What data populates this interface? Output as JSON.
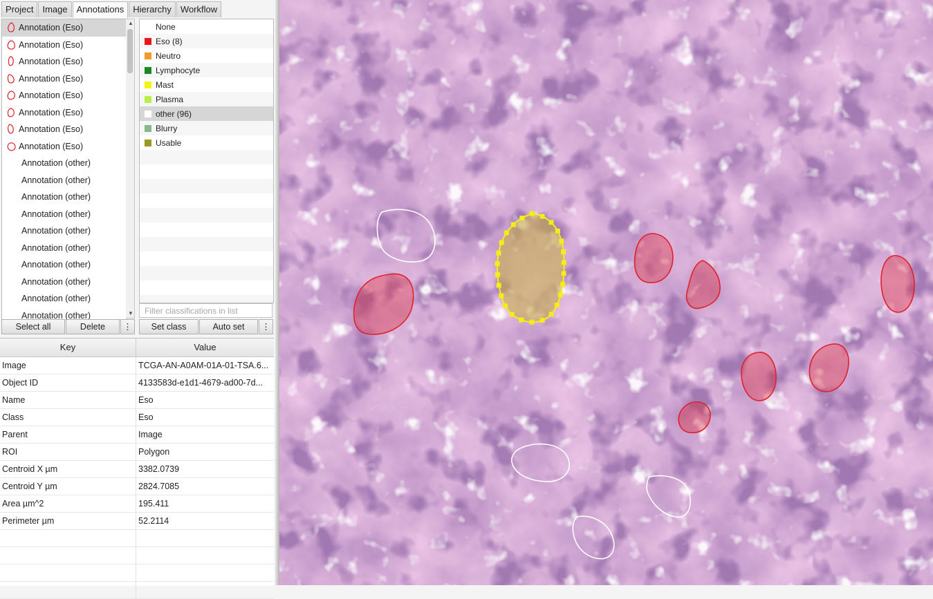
{
  "tabs": [
    "Project",
    "Image",
    "Annotations",
    "Hierarchy",
    "Workflow"
  ],
  "active_tab": "Annotations",
  "annotations": [
    {
      "label": "Annotation (Eso)",
      "color": "#e0202a",
      "selected": true
    },
    {
      "label": "Annotation (Eso)",
      "color": "#e0202a"
    },
    {
      "label": "Annotation (Eso)",
      "color": "#e0202a"
    },
    {
      "label": "Annotation (Eso)",
      "color": "#e0202a"
    },
    {
      "label": "Annotation (Eso)",
      "color": "#e0202a"
    },
    {
      "label": "Annotation (Eso)",
      "color": "#e0202a"
    },
    {
      "label": "Annotation (Eso)",
      "color": "#e0202a"
    },
    {
      "label": "Annotation (Eso)",
      "color": "#e0202a"
    },
    {
      "label": "Annotation (other)"
    },
    {
      "label": "Annotation (other)"
    },
    {
      "label": "Annotation (other)"
    },
    {
      "label": "Annotation (other)"
    },
    {
      "label": "Annotation (other)"
    },
    {
      "label": "Annotation (other)"
    },
    {
      "label": "Annotation (other)"
    },
    {
      "label": "Annotation (other)"
    },
    {
      "label": "Annotation (other)"
    },
    {
      "label": "Annotation (other)"
    }
  ],
  "annotation_buttons": {
    "select_all": "Select all",
    "delete": "Delete",
    "more": "⋮"
  },
  "classes": [
    {
      "label": "None",
      "color": null
    },
    {
      "label": "Eso (8)",
      "color": "#e8151b"
    },
    {
      "label": "Neutro",
      "color": "#f29a2c"
    },
    {
      "label": "Lymphocyte",
      "color": "#1c8a23"
    },
    {
      "label": "Mast",
      "color": "#f5f50f"
    },
    {
      "label": "Plasma",
      "color": "#b8f04a"
    },
    {
      "label": "other (96)",
      "color": "#ffffff",
      "selected": true
    },
    {
      "label": "Blurry",
      "color": "#86b98a"
    },
    {
      "label": "Usable",
      "color": "#9a9a1e"
    }
  ],
  "class_filter_placeholder": "Filter classifications in list",
  "class_buttons": {
    "set_class": "Set class",
    "auto_set": "Auto set",
    "more": "⋮"
  },
  "properties": {
    "headers": {
      "key": "Key",
      "value": "Value"
    },
    "rows": [
      {
        "key": "Image",
        "value": "TCGA-AN-A0AM-01A-01-TSA.6..."
      },
      {
        "key": "Object ID",
        "value": "4133583d-e1d1-4679-ad00-7d..."
      },
      {
        "key": "Name",
        "value": "Eso"
      },
      {
        "key": "Class",
        "value": "Eso"
      },
      {
        "key": "Parent",
        "value": "Image"
      },
      {
        "key": "ROI",
        "value": "Polygon"
      },
      {
        "key": "Centroid X µm",
        "value": "3382.0739"
      },
      {
        "key": "Centroid Y µm",
        "value": "2824.7085"
      },
      {
        "key": "Area µm^2",
        "value": "195.411"
      },
      {
        "key": "Perimeter µm",
        "value": "52.2114"
      }
    ]
  },
  "viewer": {
    "eso_annotation_color": "#e0202a",
    "other_annotation_color": "#ffffff",
    "selected_annotation_color": "#f5ec1a"
  }
}
